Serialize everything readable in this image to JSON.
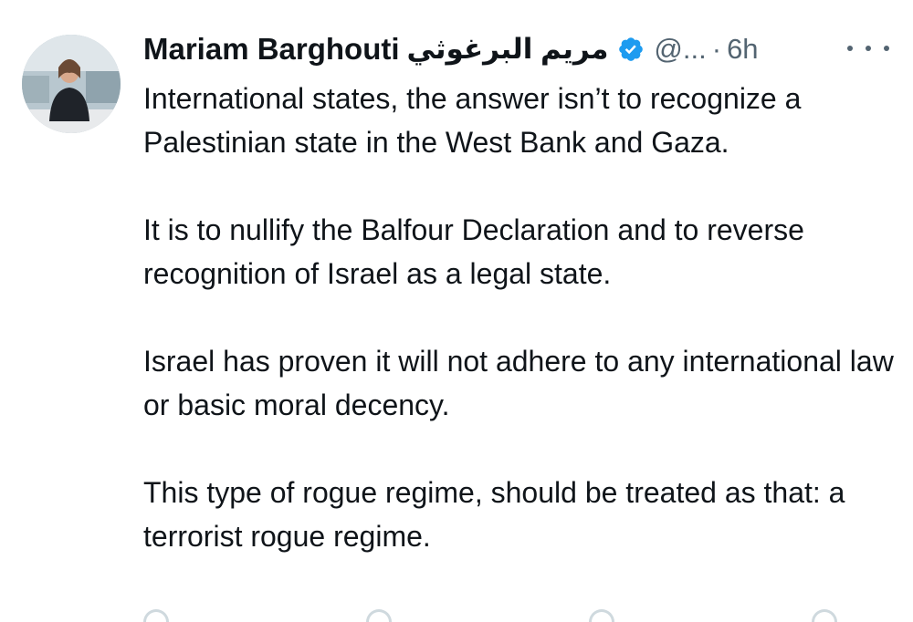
{
  "tweet": {
    "author_name": "Mariam Barghouti",
    "author_name_arabic": "مريم البرغوثي",
    "handle": "@...",
    "separator": "·",
    "time": "6h",
    "verified_color": "#1d9bf0",
    "paragraphs": [
      "International states, the answer isn’t to recognize a Palestinian state in the West Bank and Gaza.",
      "It is to nullify the Balfour Declaration and to reverse recognition of Israel as a legal state.",
      "Israel has proven it will not adhere to any international law or basic moral decency.",
      "This type of rogue regime, should be treated as that: a terrorist rogue regime."
    ]
  },
  "icons": {
    "verified": "verified-badge-icon",
    "more": "more-horizontal-icon"
  }
}
